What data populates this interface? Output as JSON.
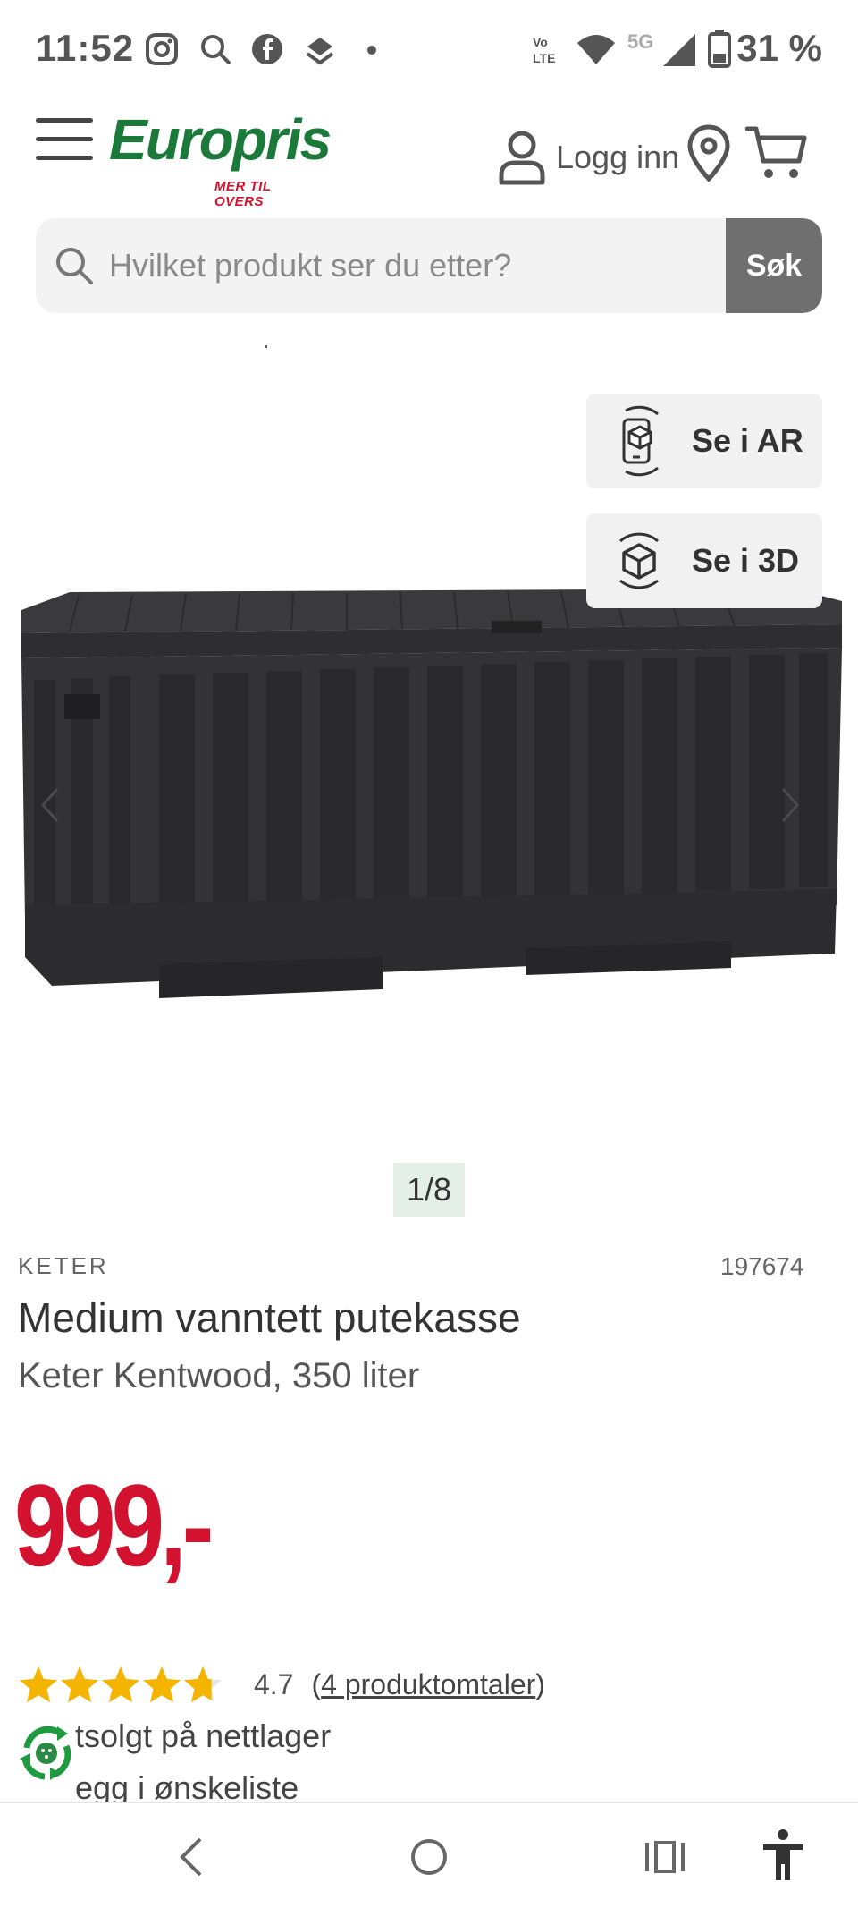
{
  "status_bar": {
    "time": "11:52",
    "network": "5G",
    "battery": "31 %",
    "icons": [
      "instagram-icon",
      "search-icon",
      "facebook-icon",
      "layers-icon",
      "dot-icon",
      "volte-icon",
      "wifi-icon",
      "signal-icon",
      "battery-icon"
    ]
  },
  "header": {
    "logo_text": "Europris",
    "logo_tagline": "MER TIL OVERS",
    "login_label": "Logg inn"
  },
  "search": {
    "placeholder": "Hvilket produkt ser du etter?",
    "button_label": "Søk"
  },
  "gallery": {
    "ar_label": "Se i AR",
    "view3d_label": "Se i 3D",
    "counter": "1/8"
  },
  "product": {
    "brand": "KETER",
    "sku": "197674",
    "title": "Medium vanntett putekasse",
    "subtitle": "Keter Kentwood, 350 liter",
    "price": "999,-",
    "rating_value": "4.7",
    "rating": 4.7,
    "reviews_open": "(",
    "reviews_label": "4 produktomtaler",
    "reviews_close": ")",
    "availability": "tsolgt på nettlager",
    "wishlist": "egg i ønskeliste"
  },
  "colors": {
    "brand_green": "#1b7a3a",
    "price_red": "#d2122e",
    "star_gold": "#f5b400",
    "search_button": "#6f6f6f"
  }
}
